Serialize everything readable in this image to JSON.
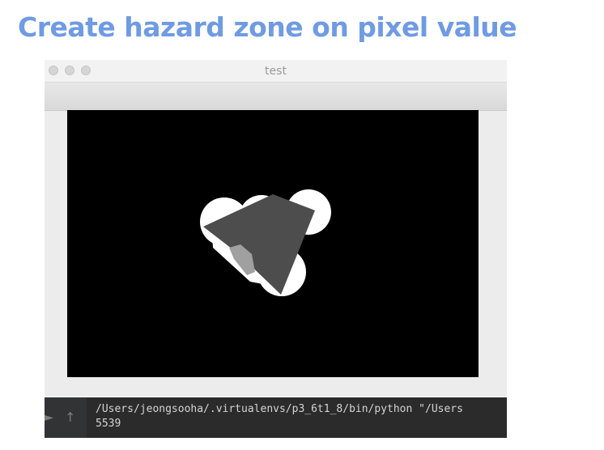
{
  "slide": {
    "title": "Create hazard zone on pixel value"
  },
  "window": {
    "title": "test"
  },
  "colors": {
    "title_accent": "#6f9be4",
    "canvas_background": "#000000",
    "hazard_zone": "#ffffff",
    "polygon": "#4d4d4d",
    "polygon_light_region": "#a0a0a0",
    "terminal_background": "#2b2b2b"
  },
  "terminal": {
    "icons": [
      "arrow-up-icon"
    ],
    "lines": [
      "/Users/jeongsooha/.virtualenvs/p3_6t1_8/bin/python \"/Users",
      "5539"
    ]
  }
}
